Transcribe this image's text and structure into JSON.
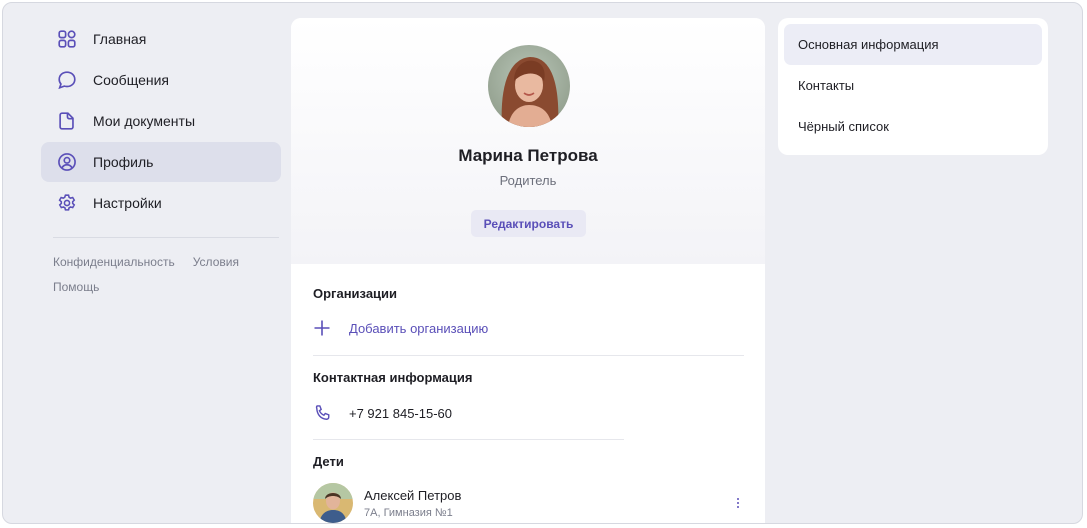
{
  "sidebar": {
    "items": [
      {
        "label": "Главная",
        "icon": "grid-icon"
      },
      {
        "label": "Сообщения",
        "icon": "chat-bubble-icon"
      },
      {
        "label": "Мои документы",
        "icon": "document-icon"
      },
      {
        "label": "Профиль",
        "icon": "user-circle-icon",
        "active": true
      },
      {
        "label": "Настройки",
        "icon": "gear-icon"
      }
    ],
    "footer": {
      "privacy": "Конфиденциальность",
      "terms": "Условия",
      "help": "Помощь"
    }
  },
  "profile": {
    "name": "Марина Петрова",
    "role": "Родитель",
    "edit_label": "Редактировать"
  },
  "organizations": {
    "title": "Организации",
    "add_label": "Добавить организацию"
  },
  "contact": {
    "title": "Контактная информация",
    "phone": "+7 921 845-15-60"
  },
  "children": {
    "title": "Дети",
    "items": [
      {
        "name": "Алексей Петров",
        "details": "7А, Гимназия №1"
      }
    ]
  },
  "right_menu": {
    "items": [
      {
        "label": "Основная информация",
        "active": true
      },
      {
        "label": "Контакты"
      },
      {
        "label": "Чёрный список"
      }
    ]
  },
  "colors": {
    "accent": "#5a4fb8",
    "background": "#edeef3",
    "active_nav": "#dddfeb"
  }
}
